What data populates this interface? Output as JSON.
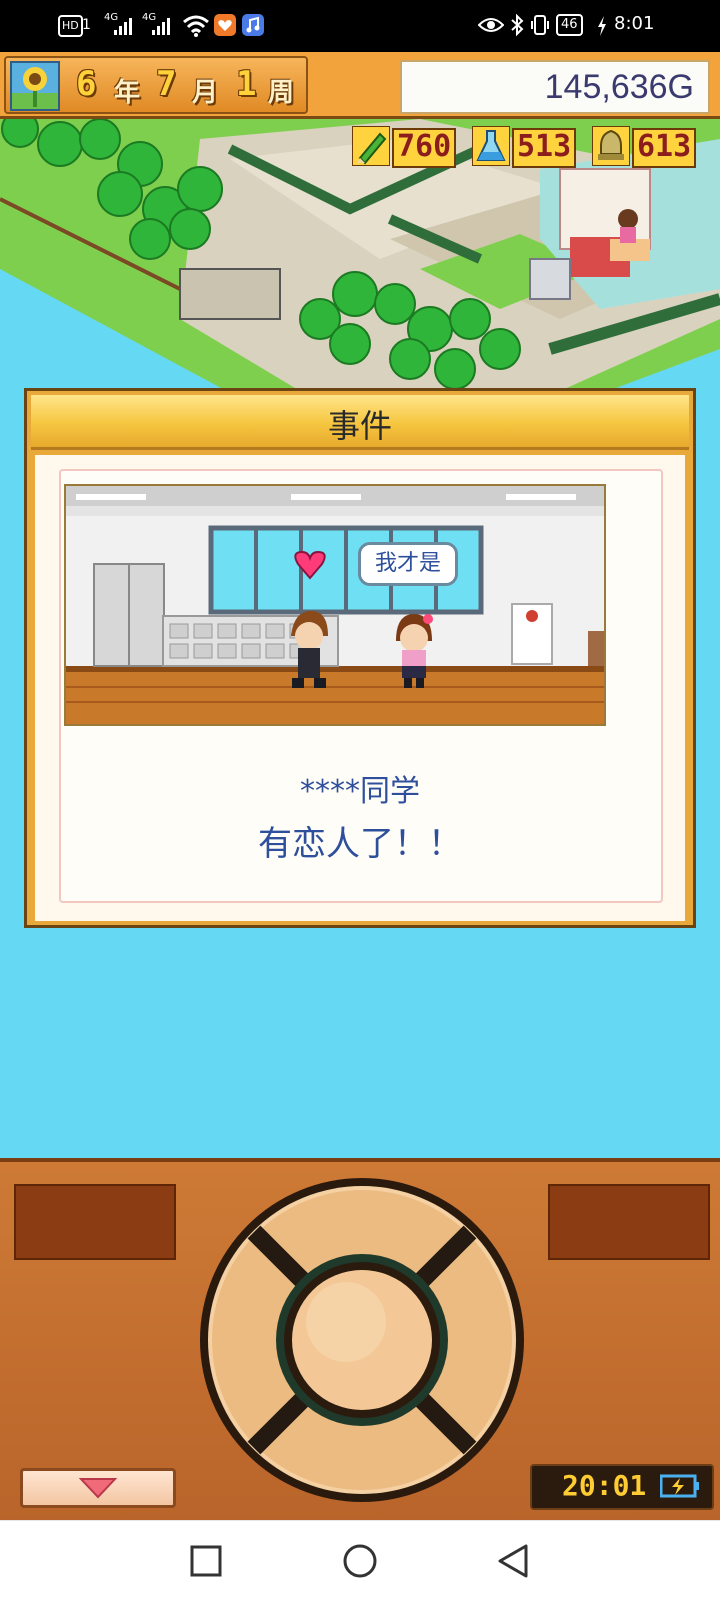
{
  "status_bar": {
    "time": "8:01",
    "battery": "46",
    "hd_label": "HD",
    "sim1": "1",
    "net1": "4G",
    "net2": "4G",
    "icons": [
      "hd-icon",
      "signal-icon",
      "signal-icon",
      "wifi-icon",
      "notification-app-icon",
      "music-app-icon",
      "eye-icon",
      "bluetooth-icon",
      "vibrate-icon",
      "battery-icon",
      "charging-icon"
    ]
  },
  "hud": {
    "year": "6",
    "year_unit": "年",
    "month": "7",
    "month_unit": "月",
    "week": "1",
    "week_unit": "周",
    "money": "145,636G"
  },
  "stats": {
    "study": "760",
    "research": "513",
    "fame": "613"
  },
  "event": {
    "title": "事件",
    "speech": "我才是",
    "message_line1": "****同学",
    "message_line2": "有恋人了！！"
  },
  "controller": {
    "clock": "20:01"
  },
  "colors": {
    "sky": "#65d9f3",
    "hud_orange": "#f2a33c",
    "message_blue": "#2e4f9c"
  }
}
